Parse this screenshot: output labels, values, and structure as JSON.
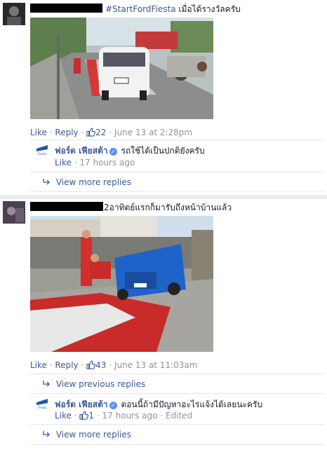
{
  "comment1": {
    "hashtag": "#StartFordFiesta",
    "text": " เมื่อได้รางวัลครับ",
    "actions": {
      "like": "Like",
      "reply": "Reply",
      "like_count": "22",
      "time": "June 13 at 2:28pm",
      "dot": "·"
    },
    "reply": {
      "author": "ฟอร์ด เฟียสต้า",
      "text": "รถใช้ได้เป็นปกติยังครับ",
      "actions": {
        "like": "Like",
        "time": "17 hours ago",
        "dot": "·"
      }
    },
    "view_more": "View more replies"
  },
  "comment2": {
    "text": "2อาทิตย์แรกก็มารับถึงหน้าบ้านแล้ว",
    "actions": {
      "like": "Like",
      "reply": "Reply",
      "like_count": "43",
      "time": "June 13 at 11:03am",
      "dot": "·"
    },
    "view_previous": "View previous replies",
    "reply": {
      "author": "ฟอร์ด เฟียสต้า",
      "text": "ตอนนี้ถ้ามีปัญหาอะไรแจ้งได้เลยนะครับ",
      "actions": {
        "like": "Like",
        "like_count": "1",
        "time": "17 hours ago",
        "edited": "Edited",
        "dot": "·"
      }
    },
    "view_more": "View more replies"
  },
  "icons": {
    "like": "thumbs-up-icon",
    "reply": "reply-arrow-icon",
    "verified": "verified-badge-icon"
  },
  "colors": {
    "link": "#3b5998",
    "meta": "#90949c",
    "verified": "#5890ff"
  }
}
